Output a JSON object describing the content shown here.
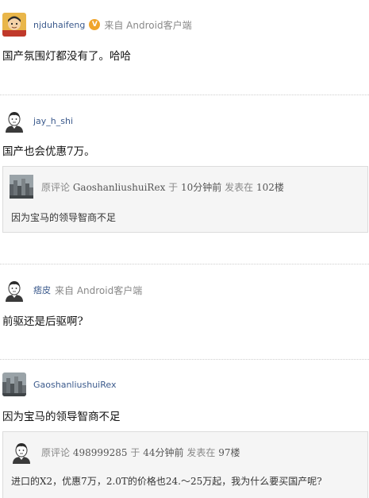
{
  "comments": [
    {
      "username": "njduhaifeng",
      "verified_badge": "V",
      "source": "来自 Android客户端",
      "text": "国产氛围灯都没有了。哈哈",
      "avatar_icon": "cartoon-boy-avatar-icon"
    },
    {
      "username": "jay_h_shi",
      "text": "国产也会优惠7万。",
      "avatar_icon": "default-user-avatar-icon",
      "quote": {
        "prefix": "原评论",
        "author": "GaoshanliushuiRex",
        "yu": "于",
        "time": "10分钟前",
        "posted_at": "发表在",
        "floor": "102楼",
        "text": "因为宝马的领导智商不足",
        "avatar_icon": "cityscape-avatar-icon"
      }
    },
    {
      "username": "痞皮",
      "source": "来自 Android客户端",
      "text": "前驱还是后驱啊?",
      "avatar_icon": "default-user-avatar-icon"
    },
    {
      "username": "GaoshanliushuiRex",
      "text": "因为宝马的领导智商不足",
      "avatar_icon": "cityscape-avatar-icon",
      "quote": {
        "prefix": "原评论",
        "author": "498999285",
        "yu": "于",
        "time": "44分钟前",
        "posted_at": "发表在",
        "floor": "97楼",
        "text": "进口的X2，优惠7万，2.0T的价格也24.～25万起，我为什么要买国产呢?",
        "avatar_icon": "default-user-avatar-icon"
      }
    }
  ],
  "colors": {
    "username": "#3b5a8c",
    "meta_gray": "#888888",
    "quote_bg": "#f5f5f5",
    "badge_orange": "#f0a52b"
  }
}
